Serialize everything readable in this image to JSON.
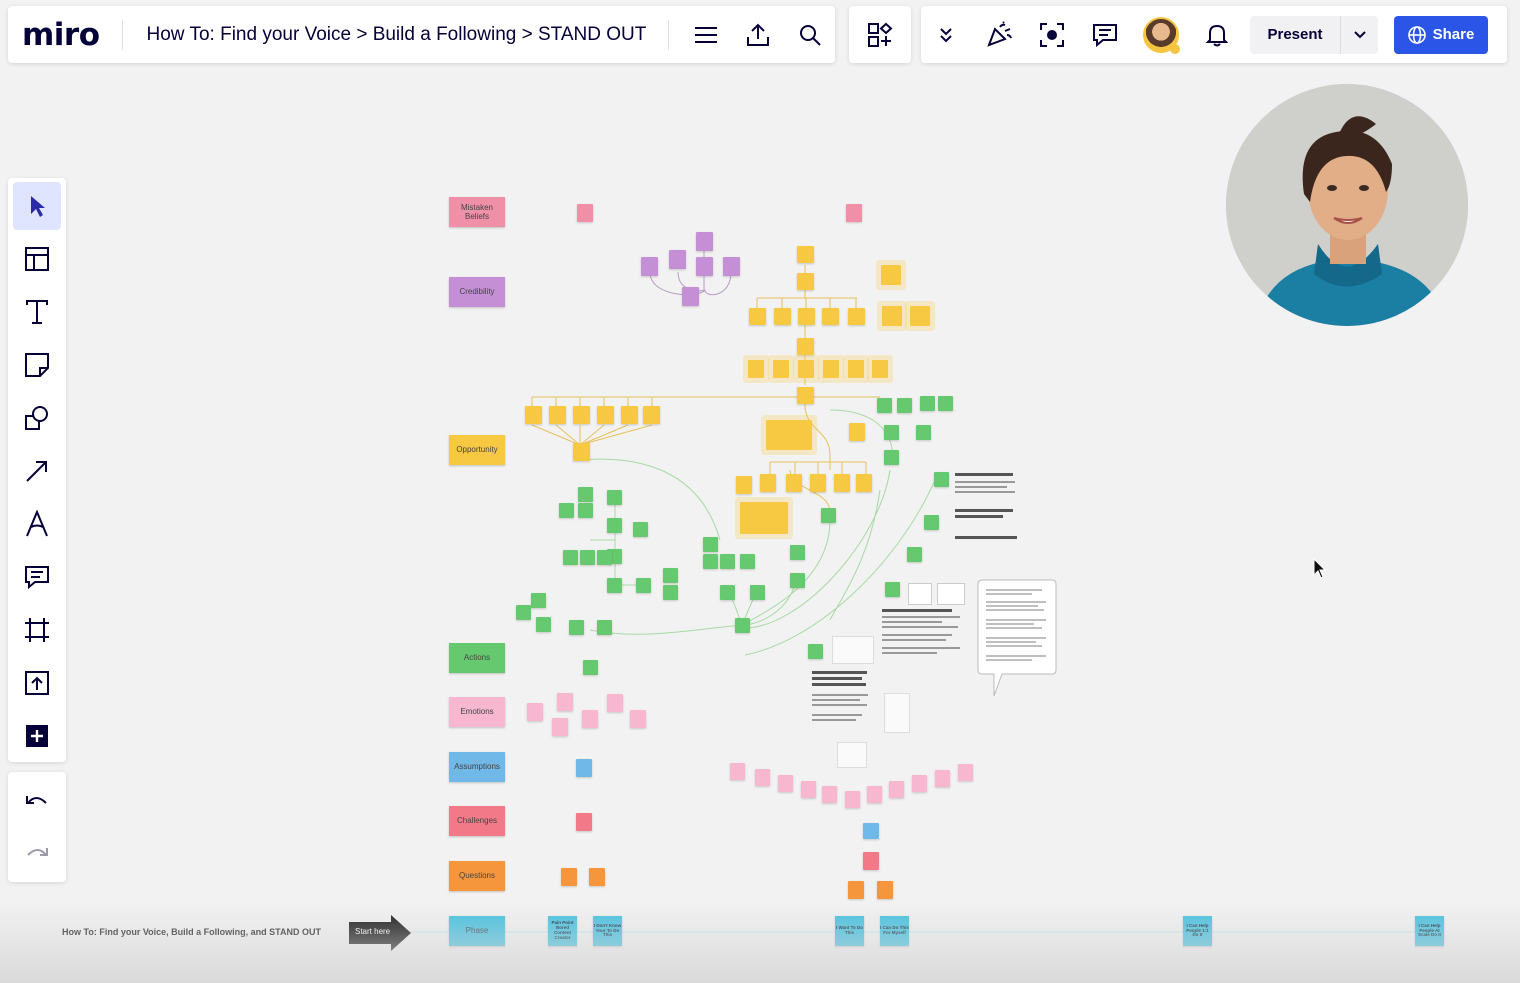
{
  "app": {
    "logo": "miro"
  },
  "header": {
    "board_title": "How To: Find your Voice > Build a Following > STAND OUT",
    "present_label": "Present",
    "share_label": "Share"
  },
  "toolbar": {
    "tools": [
      "select-tool",
      "templates-tool",
      "text-tool",
      "sticky-note-tool",
      "shapes-tool",
      "connection-line-tool",
      "pen-tool",
      "comment-tool",
      "frame-tool",
      "upload-tool",
      "more-apps-tool"
    ]
  },
  "board": {
    "row_labels": [
      {
        "label": "Mistaken Beliefs",
        "color": "#f08fa8"
      },
      {
        "label": "Credibility",
        "color": "#c58fd6"
      },
      {
        "label": "Opportunity",
        "color": "#f7c943"
      },
      {
        "label": "Actions",
        "color": "#66c96f"
      },
      {
        "label": "Emotions",
        "color": "#f7b8cf"
      },
      {
        "label": "Assumptions",
        "color": "#6fb8e8"
      },
      {
        "label": "Challenges",
        "color": "#f27a88"
      },
      {
        "label": "Questions",
        "color": "#f5963c"
      },
      {
        "label": "Phase",
        "color": "#42c1e0"
      }
    ],
    "bottom_title": "How To: Find your Voice, Build a Following, and STAND OUT",
    "start_label": "Start here",
    "phases": [
      "Pain Point Bored Content Creator",
      "I Don't Know Your To Do This",
      "I Want To Do This",
      "I Can Do This For Myself",
      "I Can Help People 1:1 Do It",
      "I Can Help People At Scale Do It"
    ]
  },
  "colors": {
    "accent": "#2b55e6",
    "canvas": "#f2f2f2",
    "yellow": "#f7c943",
    "green": "#66c96f",
    "pink": "#f7b8cf",
    "purple": "#c58fd6",
    "blue": "#6fb8e8",
    "cyan": "#42c1e0"
  }
}
